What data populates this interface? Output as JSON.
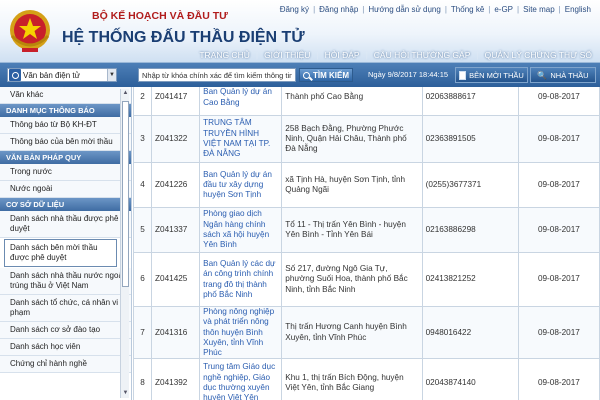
{
  "header": {
    "ministry": "BỘ KẾ HOẠCH VÀ ĐẦU TƯ",
    "system_title": "HỆ THỐNG ĐẤU THẦU ĐIỆN TỬ",
    "top_links": [
      "Đăng ký",
      "Đăng nhập",
      "Hướng dẫn sử dụng",
      "Thống kê",
      "e-GP",
      "Site map",
      "English"
    ],
    "main_nav": [
      "TRANG CHỦ",
      "GIỚI THIỆU",
      "HỎI ĐÁP",
      "CÂU HỎI THƯỜNG GẶP",
      "QUẢN LÝ CHỨNG THƯ SỐ"
    ]
  },
  "search": {
    "doc_type": "Văn bản điện tử",
    "placeholder": "Nhập từ khóa chính xác để tìm kiếm thông tin",
    "button": "TÌM KIẾM",
    "datetime": "Ngày 9/8/2017 18:44:15",
    "btn_new_invitation": "BÊN MỜI THẦU",
    "btn_contractor": "NHÀ THẦU"
  },
  "sidebar": {
    "top_item": "Văn khác",
    "sec_notices": "DANH MỤC THÔNG BÁO",
    "notices": [
      "Thông báo từ Bộ KH-ĐT",
      "Thông báo của bên mời thầu"
    ],
    "sec_legal": "VĂN BẢN PHÁP QUY",
    "legal": [
      "Trong nước",
      "Nước ngoài"
    ],
    "sec_db": "CƠ SỞ DỮ LIỆU",
    "db": [
      "Danh sách nhà thầu được phê duyệt",
      "Danh sách bên mời thầu được phê duyệt",
      "Danh sách nhà thầu nước ngoài trúng thầu ở Việt Nam",
      "Danh sách tổ chức, cá nhân vi phạm",
      "Danh sách cơ sở đào tạo",
      "Danh sách học viên",
      "Chứng chỉ hành nghề"
    ]
  },
  "table": {
    "rows": [
      {
        "no": "2",
        "code": "Z041417",
        "name": "Ban Quản lý dự án",
        "name2": "Cao Bằng",
        "addr": "Thành phố Cao Bằng",
        "phone": "02063888617",
        "date": "09-08-2017"
      },
      {
        "no": "3",
        "code": "Z041322",
        "name": "TRUNG TÂM TRUYỀN HÌNH VIỆT NAM TẠI TP. ĐÀ NẴNG",
        "addr": "258 Bạch Đằng, Phường Phước Ninh, Quận Hải Châu, Thành phố Đà Nẵng",
        "phone": "02363891505",
        "date": "09-08-2017"
      },
      {
        "no": "4",
        "code": "Z041226",
        "name": "Ban Quản lý dự án đầu tư xây dựng huyện Sơn Tịnh",
        "addr": "xã Tịnh Hà, huyện Sơn Tịnh, tỉnh Quảng Ngãi",
        "phone": "(0255)3677371",
        "date": "09-08-2017"
      },
      {
        "no": "5",
        "code": "Z041337",
        "name": "Phòng giao dịch Ngân hàng chính sách xã hội huyện Yên Bình",
        "addr": "Tổ 11 - Thị trấn Yên Bình - huyện Yên Bình - Tỉnh Yên Bái",
        "phone": "02163886298",
        "date": "09-08-2017"
      },
      {
        "no": "6",
        "code": "Z041425",
        "name": "Ban Quản lý các dự án công trình chính trang đô thị thành phố Bắc Ninh",
        "addr": "Số 217, đường Ngô Gia Tự, phường Suối Hoa, thành phố Bắc Ninh, tỉnh Bắc Ninh",
        "phone": "02413821252",
        "date": "09-08-2017"
      },
      {
        "no": "7",
        "code": "Z041316",
        "name": "Phòng nông nghiệp và phát triển nông thôn huyện Bình Xuyên, tỉnh Vĩnh Phúc",
        "addr": "Thị trấn Hương Canh huyện Bình Xuyên, tỉnh Vĩnh Phúc",
        "phone": "0948016422",
        "date": "09-08-2017"
      },
      {
        "no": "8",
        "code": "Z041392",
        "name": "Trung tâm Giáo dục nghề nghiệp, Giáo dục thường xuyên huyện Việt Yên",
        "addr": "Khu 1, thị trấn Bích Động, huyện Việt Yên, tỉnh Bắc Giang",
        "phone": "02043874140",
        "date": "09-08-2017"
      }
    ]
  }
}
